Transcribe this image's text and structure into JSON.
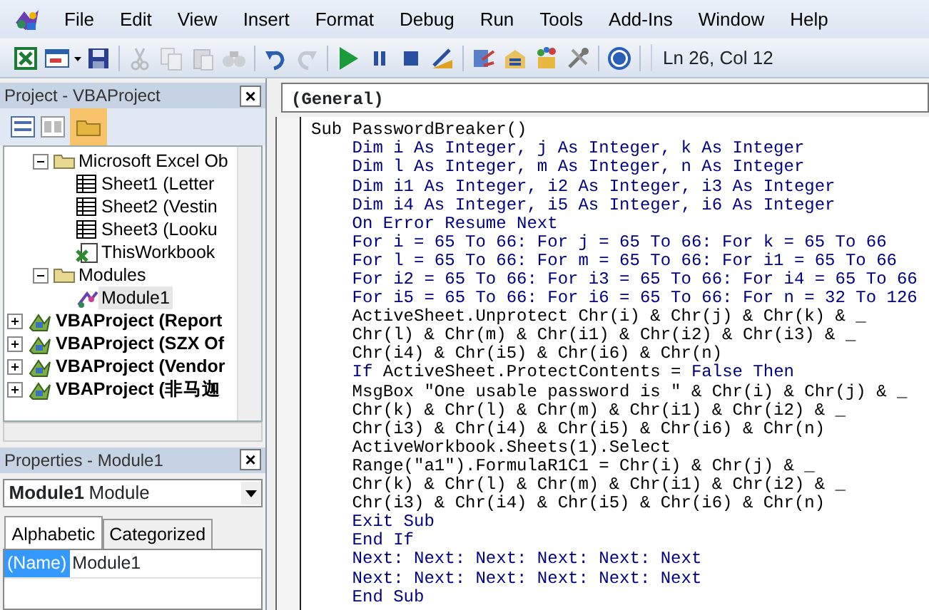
{
  "menu": [
    "File",
    "Edit",
    "View",
    "Insert",
    "Format",
    "Debug",
    "Run",
    "Tools",
    "Add-Ins",
    "Window",
    "Help"
  ],
  "toolbar": [
    {
      "kind": "excel",
      "disabled": false
    },
    {
      "kind": "form",
      "disabled": false
    },
    {
      "kind": "save",
      "disabled": false
    },
    {
      "kind": "cut",
      "disabled": true
    },
    {
      "kind": "copy",
      "disabled": true
    },
    {
      "kind": "paste",
      "disabled": true
    },
    {
      "kind": "find",
      "disabled": true
    },
    {
      "kind": "undo",
      "disabled": false
    },
    {
      "kind": "redo",
      "disabled": true
    },
    {
      "kind": "run",
      "disabled": false
    },
    {
      "kind": "pause",
      "disabled": false
    },
    {
      "kind": "stop",
      "disabled": false
    },
    {
      "kind": "design",
      "disabled": false
    },
    {
      "kind": "project",
      "disabled": false
    },
    {
      "kind": "properties",
      "disabled": false
    },
    {
      "kind": "browser",
      "disabled": false
    },
    {
      "kind": "tools",
      "disabled": false
    },
    {
      "kind": "help",
      "disabled": false
    }
  ],
  "cursor_position": "Ln 26, Col 12",
  "project_pane": {
    "title": "Project - VBAProject",
    "close": "×",
    "tree_partial": [
      {
        "label": "Microsoft Excel Ob",
        "kind": "folder",
        "expanded": true,
        "selected": false,
        "children": [
          {
            "label": "Sheet1 (Letter",
            "kind": "sheet",
            "selected": false
          },
          {
            "label": "Sheet2 (Vestin",
            "kind": "sheet",
            "selected": false
          },
          {
            "label": "Sheet3 (Looku",
            "kind": "sheet",
            "selected": false
          },
          {
            "label": "ThisWorkbook",
            "kind": "workbook",
            "selected": false
          }
        ]
      },
      {
        "label": "Modules",
        "kind": "folder",
        "expanded": true,
        "selected": false,
        "children": [
          {
            "label": "Module1",
            "kind": "module",
            "selected": true
          }
        ]
      }
    ],
    "projects": [
      {
        "label": "VBAProject (Report",
        "expanded": false,
        "selected": false
      },
      {
        "label": "VBAProject (SZX Of",
        "expanded": false,
        "selected": false
      },
      {
        "label": "VBAProject (Vendor",
        "expanded": false,
        "selected": false
      },
      {
        "label": "VBAProject (非马迦",
        "expanded": false,
        "selected": false
      }
    ]
  },
  "properties_pane": {
    "title": "Properties - Module1",
    "close": "×",
    "object_name": "Module1",
    "object_type": "Module",
    "tabs": [
      {
        "label": "Alphabetic",
        "selected": true
      },
      {
        "label": "Categorized",
        "selected": false
      }
    ],
    "rows": [
      {
        "name": "(Name)",
        "value": "Module1",
        "selected": true
      }
    ]
  },
  "code_window": {
    "object_box": "(General)",
    "lines": [
      [
        {
          "text": "Sub PasswordBreaker()",
          "kind": "plain"
        }
      ],
      [
        {
          "text": "    Dim i As Integer, j As Integer, k As Integer",
          "kind": "keyword"
        }
      ],
      [
        {
          "text": "    Dim l As Integer, m As Integer, n As Integer",
          "kind": "keyword"
        }
      ],
      [
        {
          "text": "    Dim i1 As Integer, i2 As Integer, i3 As Integer",
          "kind": "keyword"
        }
      ],
      [
        {
          "text": "    Dim i4 As Integer, i5 As Integer, i6 As Integer",
          "kind": "keyword"
        }
      ],
      [
        {
          "text": "    On Error Resume Next",
          "kind": "keyword"
        }
      ],
      [
        {
          "text": "    For i = 65 To 66: For j = 65 To 66: For k = 65 To 66",
          "kind": "keyword"
        }
      ],
      [
        {
          "text": "    For l = 65 To 66: For m = 65 To 66: For i1 = 65 To 66",
          "kind": "keyword"
        }
      ],
      [
        {
          "text": "    For i2 = 65 To 66: For i3 = 65 To 66: For i4 = 65 To 66",
          "kind": "keyword"
        }
      ],
      [
        {
          "text": "    For i5 = 65 To 66: For i6 = 65 To 66: For n = 32 To 126",
          "kind": "keyword"
        }
      ],
      [
        {
          "text": "    ActiveSheet.Unprotect Chr(i) & Chr(j) & Chr(k) & _",
          "kind": "plain"
        }
      ],
      [
        {
          "text": "    Chr(l) & Chr(m) & Chr(i1) & Chr(i2) & Chr(i3) & _",
          "kind": "plain"
        }
      ],
      [
        {
          "text": "    Chr(i4) & Chr(i5) & Chr(i6) & Chr(n)",
          "kind": "plain"
        }
      ],
      [
        {
          "text": "    If",
          "kind": "keyword"
        },
        {
          "text": " ActiveSheet.ProtectContents = ",
          "kind": "plain"
        },
        {
          "text": "False Then",
          "kind": "keyword"
        }
      ],
      [
        {
          "text": "    MsgBox \"One usable password is \" & Chr(i) & Chr(j) & _",
          "kind": "plain"
        }
      ],
      [
        {
          "text": "    Chr(k) & Chr(l) & Chr(m) & Chr(i1) & Chr(i2) & _",
          "kind": "plain"
        }
      ],
      [
        {
          "text": "    Chr(i3) & Chr(i4) & Chr(i5) & Chr(i6) & Chr(n)",
          "kind": "plain"
        }
      ],
      [
        {
          "text": "    ActiveWorkbook.Sheets(1).Select",
          "kind": "plain"
        }
      ],
      [
        {
          "text": "    Range(\"a1\").FormulaR1C1 = Chr(i) & Chr(j) & _",
          "kind": "plain"
        }
      ],
      [
        {
          "text": "    Chr(k) & Chr(l) & Chr(m) & Chr(i1) & Chr(i2) & _",
          "kind": "plain"
        }
      ],
      [
        {
          "text": "    Chr(i3) & Chr(i4) & Chr(i5) & Chr(i6) & Chr(n)",
          "kind": "plain"
        }
      ],
      [
        {
          "text": "    Exit Sub",
          "kind": "keyword"
        }
      ],
      [
        {
          "text": "    End If",
          "kind": "keyword"
        }
      ],
      [
        {
          "text": "    Next: Next: Next: Next: Next: Next",
          "kind": "keyword"
        }
      ],
      [
        {
          "text": "    Next: Next: Next: Next: Next: Next",
          "kind": "keyword"
        }
      ],
      [
        {
          "text": "    End Sub",
          "kind": "keyword"
        }
      ]
    ]
  }
}
